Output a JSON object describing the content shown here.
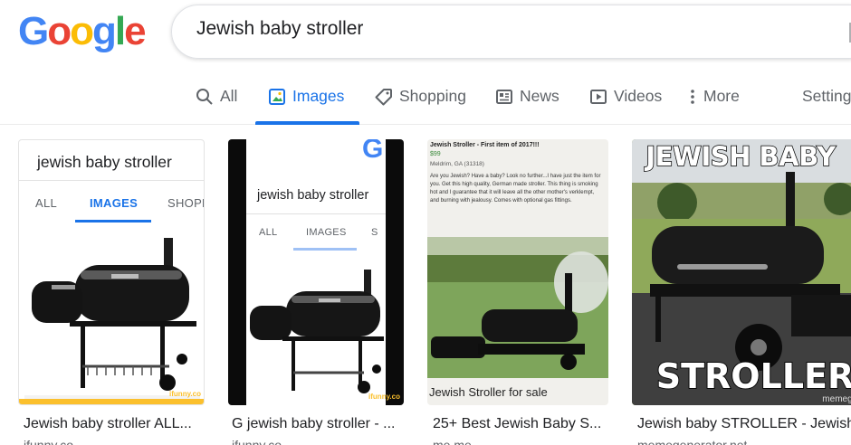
{
  "logo": {
    "text": "Google",
    "letters": [
      "G",
      "o",
      "o",
      "g",
      "l",
      "e"
    ],
    "colors": [
      "#4285f4",
      "#ea4335",
      "#fbbc05",
      "#4285f4",
      "#34a853",
      "#ea4335"
    ]
  },
  "search": {
    "value": "Jewish baby stroller"
  },
  "tabs": [
    {
      "label": "All",
      "icon": "search-icon"
    },
    {
      "label": "Images",
      "icon": "image-icon",
      "active": true
    },
    {
      "label": "Shopping",
      "icon": "tag-icon"
    },
    {
      "label": "News",
      "icon": "newspaper-icon"
    },
    {
      "label": "Videos",
      "icon": "play-icon"
    },
    {
      "label": "More",
      "icon": "more-vert-icon"
    },
    {
      "label": "Setting"
    }
  ],
  "accent_color": "#1a73e8",
  "results": [
    {
      "caption": "Jewish baby stroller ALL...",
      "source": "ifunny.co",
      "thumb": {
        "query": "jewish baby stroller",
        "tabs": [
          "ALL",
          "IMAGES",
          "SHOPP"
        ],
        "watermark": "ifunny.co"
      }
    },
    {
      "caption": "G jewish baby stroller - ...",
      "source": "ifunny.co",
      "thumb": {
        "g": "G",
        "query": "jewish baby stroller",
        "tabs": [
          "ALL",
          "IMAGES",
          "S"
        ],
        "watermark": "ifunny.co"
      }
    },
    {
      "caption": "25+ Best Jewish Baby S...",
      "source": "me.me",
      "thumb": {
        "head": "Jewish Stroller - First item of 2017!!!",
        "price": "$99",
        "location": "Meldrim, GA (31318)",
        "body": "Are you Jewish? Have a baby? Look no further...I have just the item for you. Get this high quality, German made stroller. This thing is smoking hot and I guarantee that it will leave all the other mother's verklempt, and burning with jealousy. Comes with optional gas fittings.",
        "sale": "Jewish Stroller for sale"
      }
    },
    {
      "caption": "Jewish baby STROLLER - Jewish",
      "source": "memegenerator.net",
      "thumb": {
        "top_text": "JEWISH BABY",
        "bottom_text": "STROLLER",
        "watermark": "memegenerat"
      }
    }
  ]
}
